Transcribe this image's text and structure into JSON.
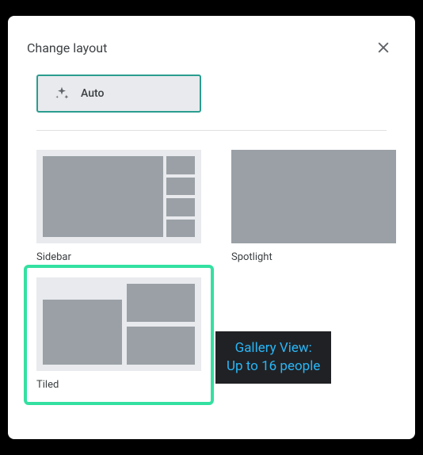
{
  "dialog": {
    "title": "Change layout"
  },
  "auto": {
    "label": "Auto"
  },
  "options": {
    "sidebar": {
      "label": "Sidebar"
    },
    "spotlight": {
      "label": "Spotlight"
    },
    "tiled": {
      "label": "Tiled"
    }
  },
  "tooltip": {
    "line1": "Gallery View:",
    "line2": "Up to 16 people"
  }
}
